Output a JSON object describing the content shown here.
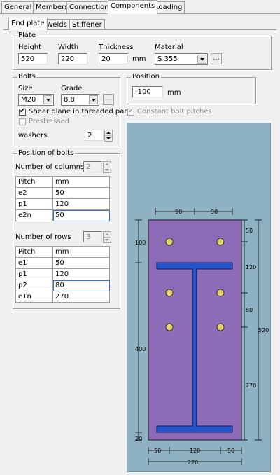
{
  "tabs": [
    "General",
    "Members",
    "Connection",
    "Components",
    "Loading"
  ],
  "subtabs": [
    "End plate",
    "Welds",
    "Stiffener"
  ],
  "plate": {
    "title": "Plate",
    "height_label": "Height",
    "height_value": "520",
    "width_label": "Width",
    "width_value": "220",
    "thickness_label": "Thickness",
    "thickness_value": "20",
    "thickness_unit": "mm",
    "material_label": "Material",
    "material_value": "S 355",
    "dots": "..."
  },
  "bolts": {
    "title": "Bolts",
    "size_label": "Size",
    "size_value": "M20",
    "grade_label": "Grade",
    "grade_value": "8.8",
    "dots": "...",
    "shear_label": "Shear plane in threaded part",
    "prestressed_label": "Prestressed",
    "washers_label": "washers",
    "washers_value": "2"
  },
  "position": {
    "title": "Position",
    "value": "-100",
    "unit": "mm",
    "constant_pitches_label": "Constant bolt pitches"
  },
  "bolt_positions": {
    "title": "Position of bolts",
    "columns_label": "Number of columns",
    "columns_value": "2",
    "columns_table": {
      "header": [
        "Pitch",
        "mm"
      ],
      "rows": [
        [
          "e2",
          "50"
        ],
        [
          "p1",
          "120"
        ],
        [
          "e2n",
          "50"
        ]
      ]
    },
    "rows_label": "Number of rows",
    "rows_value": "3",
    "rows_table": {
      "header": [
        "Pitch",
        "mm"
      ],
      "rows": [
        [
          "e1",
          "50"
        ],
        [
          "p1",
          "120"
        ],
        [
          "p2",
          "80"
        ],
        [
          "e1n",
          "270"
        ]
      ]
    }
  },
  "drawing": {
    "top_dims": [
      "90",
      "90"
    ],
    "left_dims": [
      "100",
      "400",
      "20"
    ],
    "right_dims": [
      "50",
      "120",
      "80",
      "270",
      "520"
    ],
    "bottom_dims": [
      "50",
      "120",
      "50"
    ],
    "bottom_total": "220",
    "colors": {
      "background": "#8eb2c2",
      "plate": "#8e6bb6",
      "beam": "#2255cc",
      "bolt": "#e5d26a"
    }
  }
}
